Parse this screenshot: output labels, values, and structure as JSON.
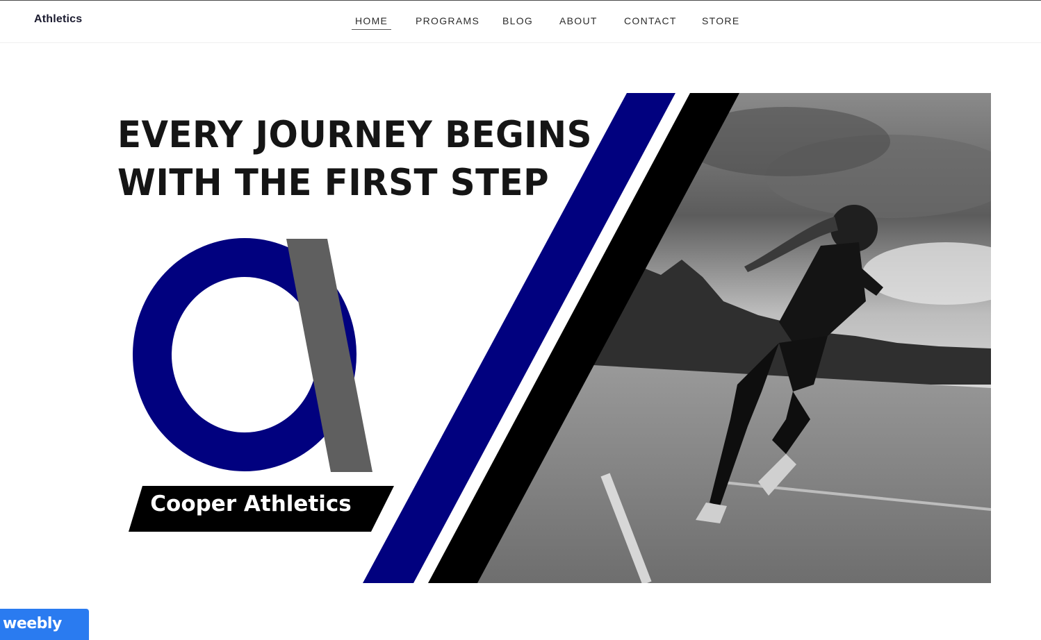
{
  "header": {
    "logo_text": "Athletics"
  },
  "nav": {
    "items": [
      {
        "label": "HOME",
        "active": true
      },
      {
        "label": "PROGRAMS"
      },
      {
        "label": "BLOG"
      },
      {
        "label": "ABOUT"
      },
      {
        "label": "CONTACT"
      },
      {
        "label": "STORE"
      }
    ]
  },
  "hero": {
    "headline_line1": "EVERY JOURNEY BEGINS",
    "headline_line2": "WITH THE FIRST STEP",
    "brand_name": "Cooper Athletics",
    "photo_subject": "girl sprinting on soccer field (black and white)"
  },
  "badge": {
    "label": "weebly"
  },
  "colors": {
    "brand_navy": "#01017f",
    "brand_gray": "#5f5f5f",
    "stripe_black": "#000000",
    "badge_blue": "#2a7bf0",
    "text_dark": "#151515"
  }
}
